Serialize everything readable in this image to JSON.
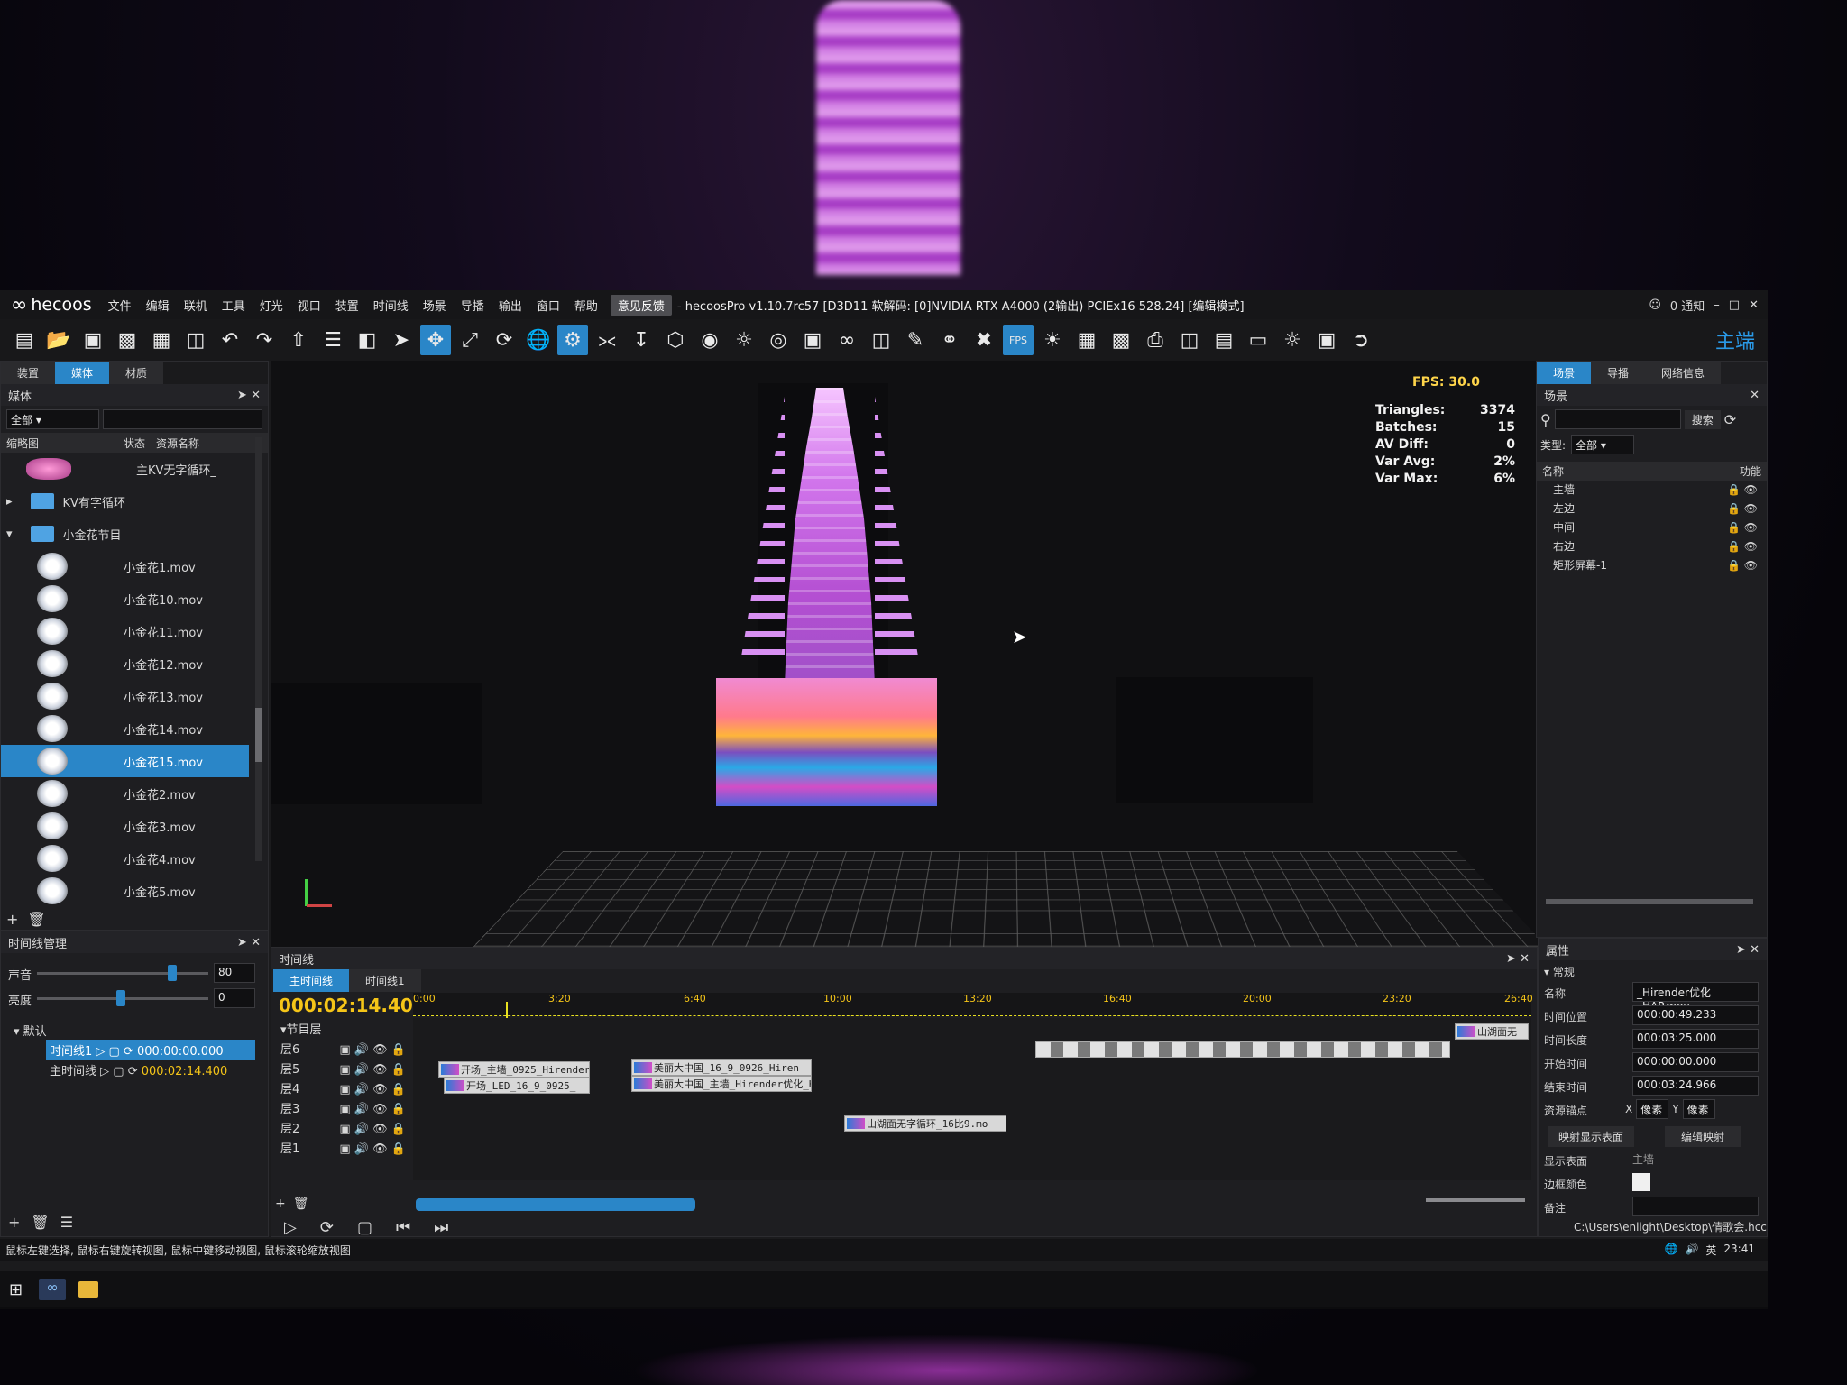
{
  "app": {
    "logo": "hecoos",
    "window_title": "- hecoosPro v1.10.7rc57 [D3D11 软解码: [0]NVIDIA RTX A4000 (2输出) PCIEx16 528.24] [编辑模式]",
    "notify": "0 通知",
    "feedback": "意见反馈",
    "mode_label": "主端"
  },
  "menu": [
    "文件",
    "编辑",
    "联机",
    "工具",
    "灯光",
    "视口",
    "装置",
    "时间线",
    "场景",
    "导播",
    "输出",
    "窗口",
    "帮助"
  ],
  "left_tabs": [
    "装置",
    "媒体",
    "材质"
  ],
  "media_panel": {
    "title": "媒体",
    "filter_value": "全部",
    "col_thumb": "缩略图",
    "col_state": "状态",
    "col_name": "资源名称",
    "top_item": "主KV无字循环_",
    "folders": [
      "KV有字循环",
      "小金花节目"
    ],
    "files": [
      "小金花1.mov",
      "小金花10.mov",
      "小金花11.mov",
      "小金花12.mov",
      "小金花13.mov",
      "小金花14.mov",
      "小金花15.mov",
      "小金花2.mov",
      "小金花3.mov",
      "小金花4.mov",
      "小金花5.mov"
    ],
    "selected_index": 6
  },
  "viewport_stats": {
    "fps_label": "FPS:",
    "fps": "30.0",
    "rows": [
      [
        "Triangles:",
        "3374"
      ],
      [
        "Batches:",
        "15"
      ],
      [
        "AV Diff:",
        "0"
      ],
      [
        "Var Avg:",
        "2%"
      ],
      [
        "Var Max:",
        "6%"
      ]
    ]
  },
  "scene_panel": {
    "tabs": [
      "场景",
      "导播",
      "网络信息"
    ],
    "title": "场景",
    "search_btn": "搜索",
    "type_label": "类型:",
    "type_value": "全部",
    "col_name": "名称",
    "col_func": "功能",
    "items": [
      "主墙",
      "左边",
      "中间",
      "右边",
      "矩形屏幕-1"
    ]
  },
  "timeline_mgr": {
    "title": "时间线管理",
    "volume_label": "声音",
    "volume": "80",
    "brightness_label": "亮度",
    "brightness": "0",
    "group": "默认",
    "timelines": [
      {
        "name": "时间线1",
        "time": "000:00:00.000"
      },
      {
        "name": "主时间线",
        "time": "000:02:14.400"
      }
    ]
  },
  "timeline": {
    "title": "时间线",
    "tabs": [
      "主时间线",
      "时间线1"
    ],
    "current_time": "000:02:14.400",
    "ruler": [
      "0:00",
      "3:20",
      "6:40",
      "10:00",
      "13:20",
      "16:40",
      "20:00",
      "23:20",
      "26:40"
    ],
    "root": "节目层",
    "layers": [
      "层6",
      "层5",
      "层4",
      "层3",
      "层2",
      "层1"
    ],
    "clips": [
      {
        "label": "开场_主墙_0925_Hirender",
        "layer": "层5"
      },
      {
        "label": "开场_LED_16_9_0925_",
        "layer": "层4"
      },
      {
        "label": "美丽大中国_16_9_0926_Hiren",
        "layer": "层5"
      },
      {
        "label": "美丽大中国_主墙_Hirender优化_HV",
        "layer": "层4"
      },
      {
        "label": "山湖面无字循环_16比9.mo",
        "layer": "层2"
      },
      {
        "label": "山湖面无",
        "layer": "层6"
      }
    ]
  },
  "properties": {
    "title": "属性",
    "section": "常规",
    "fields": [
      [
        "名称",
        "_Hirender优化_HAP.mov"
      ],
      [
        "时间位置",
        "000:00:49.233"
      ],
      [
        "时间长度",
        "000:03:25.000"
      ],
      [
        "开始时间",
        "000:00:00.000"
      ],
      [
        "结束时间",
        "000:03:24.966"
      ]
    ],
    "anchor_label": "资源锚点",
    "anchor_x": "X",
    "anchor_x_unit": "像素",
    "anchor_y": "Y",
    "anchor_y_unit": "像素",
    "btn_map": "映射显示表面",
    "btn_edit": "编辑映射",
    "display_label": "显示表面",
    "display_value": "主墙",
    "border_label": "边框颜色",
    "note_label": "备注",
    "path": "C:\\Users\\enlight\\Desktop\\倩歌会.hcc"
  },
  "status_bar": "鼠标左键选择, 鼠标右键旋转视图, 鼠标中键移动视图, 鼠标滚轮缩放视图",
  "tray": {
    "ime": "英",
    "time": "23:41"
  },
  "colors": {
    "accent": "#2a86c8",
    "timecode": "#f5c518",
    "playhead": "#e8e020"
  }
}
